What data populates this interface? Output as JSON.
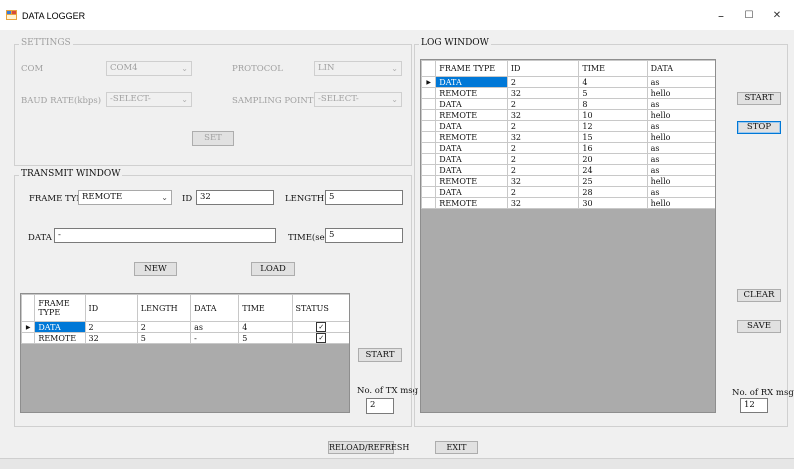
{
  "window": {
    "title": "DATA LOGGER",
    "minimize_glyph": "–",
    "maximize_glyph": "☐",
    "close_glyph": "✕"
  },
  "settings": {
    "title": "SETTINGS",
    "com_label": "COM",
    "com_value": "COM4",
    "protocol_label": "PROTOCOL",
    "protocol_value": "LIN",
    "baud_label": "BAUD RATE(kbps)",
    "baud_value": "-SELECT-",
    "sampling_label": "SAMPLING POINT(%)",
    "sampling_value": "-SELECT-",
    "set_label": "SET"
  },
  "transmit": {
    "title": "TRANSMIT WINDOW",
    "frame_type_label": "FRAME TYPE",
    "frame_type_value": "REMOTE",
    "id_label": "ID",
    "id_value": "32",
    "length_label": "LENGTH",
    "length_value": "5",
    "data_label": "DATA",
    "data_value": "-",
    "time_label": "TIME(sec)",
    "time_value": "5",
    "new_label": "NEW",
    "load_label": "LOAD",
    "start_label": "START",
    "tx_count_label": "No. of TX msg",
    "tx_count_value": "2",
    "columns": [
      "FRAME TYPE",
      "ID",
      "LENGTH",
      "DATA",
      "TIME",
      "STATUS"
    ],
    "rows": [
      {
        "frame": "DATA",
        "id": "2",
        "length": "2",
        "data": "as",
        "time": "4",
        "status": true
      },
      {
        "frame": "REMOTE",
        "id": "32",
        "length": "5",
        "data": "-",
        "time": "5",
        "status": true
      }
    ]
  },
  "log": {
    "title": "LOG WINDOW",
    "columns": [
      "FRAME TYPE",
      "ID",
      "TIME",
      "DATA"
    ],
    "rows": [
      {
        "frame": "DATA",
        "id": "2",
        "time": "4",
        "data": "as"
      },
      {
        "frame": "REMOTE",
        "id": "32",
        "time": "5",
        "data": "hello"
      },
      {
        "frame": "DATA",
        "id": "2",
        "time": "8",
        "data": "as"
      },
      {
        "frame": "REMOTE",
        "id": "32",
        "time": "10",
        "data": "hello"
      },
      {
        "frame": "DATA",
        "id": "2",
        "time": "12",
        "data": "as"
      },
      {
        "frame": "REMOTE",
        "id": "32",
        "time": "15",
        "data": "hello"
      },
      {
        "frame": "DATA",
        "id": "2",
        "time": "16",
        "data": "as"
      },
      {
        "frame": "DATA",
        "id": "2",
        "time": "20",
        "data": "as"
      },
      {
        "frame": "DATA",
        "id": "2",
        "time": "24",
        "data": "as"
      },
      {
        "frame": "REMOTE",
        "id": "32",
        "time": "25",
        "data": "hello"
      },
      {
        "frame": "DATA",
        "id": "2",
        "time": "28",
        "data": "as"
      },
      {
        "frame": "REMOTE",
        "id": "32",
        "time": "30",
        "data": "hello"
      }
    ],
    "start_label": "START",
    "stop_label": "STOP",
    "clear_label": "CLEAR",
    "save_label": "SAVE",
    "rx_count_label": "No. of RX msg",
    "rx_count_value": "12"
  },
  "footer": {
    "reload_label": "RELOAD/REFRESH",
    "exit_label": "EXIT"
  },
  "colors": {
    "selection": "#0078d7",
    "grid_background": "#ababab",
    "window_background": "#f0f0f0"
  }
}
